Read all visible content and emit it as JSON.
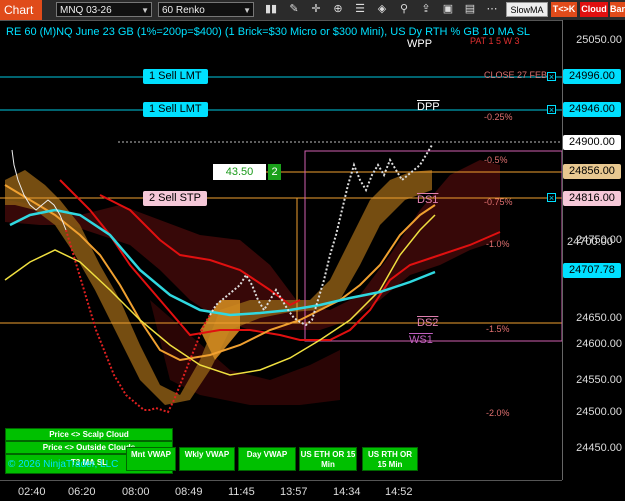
{
  "toolbar": {
    "chart_label": "Chart",
    "instrument": "MNQ 03-26",
    "period": "60 Renko",
    "indicator": "SlowMA",
    "tc_tag": "T<>K",
    "cloud_tag": "Cloud",
    "bar_tag": "Bar"
  },
  "chart_title": "RE 60 (M)NQ June 23 GB (1%=200p=$400) (1 Brick=$30 Micro or $300 Mini), US Dy RTH % GB 10 MA SL",
  "y_axis": [
    "25050.00",
    "24750.00",
    "24700.00",
    "24650.00",
    "24600.00",
    "24550.00",
    "24500.00",
    "24450.00"
  ],
  "price_labels": [
    {
      "text": "24996.00",
      "style": "cyan"
    },
    {
      "text": "24946.00",
      "style": "cyan"
    },
    {
      "text": "24900.00",
      "style": "white"
    },
    {
      "text": "24856.00",
      "style": "tan"
    },
    {
      "text": "24816.00",
      "style": "pink"
    },
    {
      "text": "24707.78",
      "style": "cyan"
    }
  ],
  "x_axis": [
    "02:40",
    "06:20",
    "08:00",
    "08:49",
    "11:45",
    "13:57",
    "14:34",
    "14:52"
  ],
  "orders": [
    {
      "label": "1 Sell LMT"
    },
    {
      "label": "1 Sell LMT"
    },
    {
      "label": "2 Sell STP"
    }
  ],
  "position_box": {
    "value": "43.50",
    "qty": "2"
  },
  "levels": [
    "WPP",
    "DPP",
    "DS1",
    "DS2",
    "WS1"
  ],
  "level_text": {
    "close": "CLOSE 27 FEB",
    "top_right": "PAT 1 5 W 3"
  },
  "pcts": [
    "-0.25%",
    "-0.5%",
    "-0.75%",
    "-1.0%",
    "-1.5%",
    "-2.0%"
  ],
  "panel": {
    "scalp": "Price <> Scalp Cloud",
    "outside": "Price <> Outside Clouds",
    "ma_sl": "T3 MA SL",
    "copyright": "© 2026 NinjaTrader, LLC"
  },
  "buttons": [
    "Mnt VWAP",
    "Wkly VWAP",
    "Day VWAP",
    "US ETH OR 15 Min",
    "US RTH OR 15 Min"
  ],
  "colors": {
    "accent": "#e04b1a",
    "cyan": "#00e0ff",
    "green": "#00c000",
    "orange": "#f0a030",
    "red": "#e01010"
  },
  "icons": [
    "close-x-icon",
    "dropdown-arrow-icon"
  ]
}
